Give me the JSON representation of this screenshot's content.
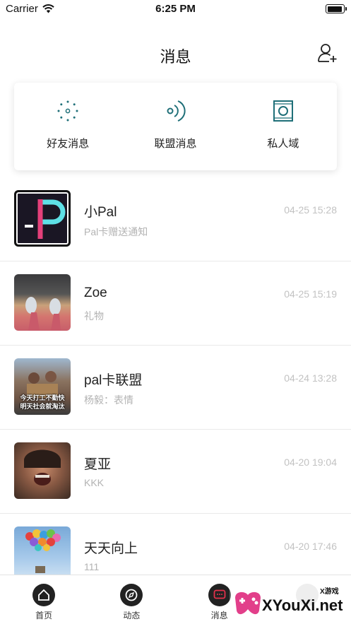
{
  "status_bar": {
    "carrier": "Carrier",
    "time": "6:25 PM"
  },
  "nav": {
    "title": "消息",
    "add_icon": "add-user-icon"
  },
  "categories": [
    {
      "label": "好友消息",
      "icon": "friends-dots-icon"
    },
    {
      "label": "联盟消息",
      "icon": "signal-waves-icon"
    },
    {
      "label": "私人域",
      "icon": "square-circle-icon"
    }
  ],
  "messages": [
    {
      "name": "小Pal",
      "preview": "Pal卡赠送通知",
      "time": "04-25 15:28"
    },
    {
      "name": "Zoe",
      "preview": "礼物",
      "time": "04-25 15:19"
    },
    {
      "name": "pal卡联盟",
      "preview": "杨毅：表情",
      "time": "04-24 13:28",
      "avatar_caption": "今天打工不勤快\n明天社会就淘汰"
    },
    {
      "name": "夏亚",
      "preview": "KKK",
      "time": "04-20 19:04"
    },
    {
      "name": "天天向上",
      "preview": "111",
      "time": "04-20 17:46"
    }
  ],
  "tabs": [
    {
      "label": "首页",
      "icon": "home-icon",
      "active": false
    },
    {
      "label": "动态",
      "icon": "compass-icon",
      "active": false
    },
    {
      "label": "消息",
      "icon": "message-icon",
      "active": true
    },
    {
      "label": "",
      "icon": "profile-icon",
      "active": false
    }
  ],
  "watermark": {
    "text": "XYouXi.net",
    "small": "X游戏"
  },
  "colors": {
    "accent": "#e5314b",
    "teal": "#1f6f78",
    "muted_text": "#b3b3b3"
  }
}
